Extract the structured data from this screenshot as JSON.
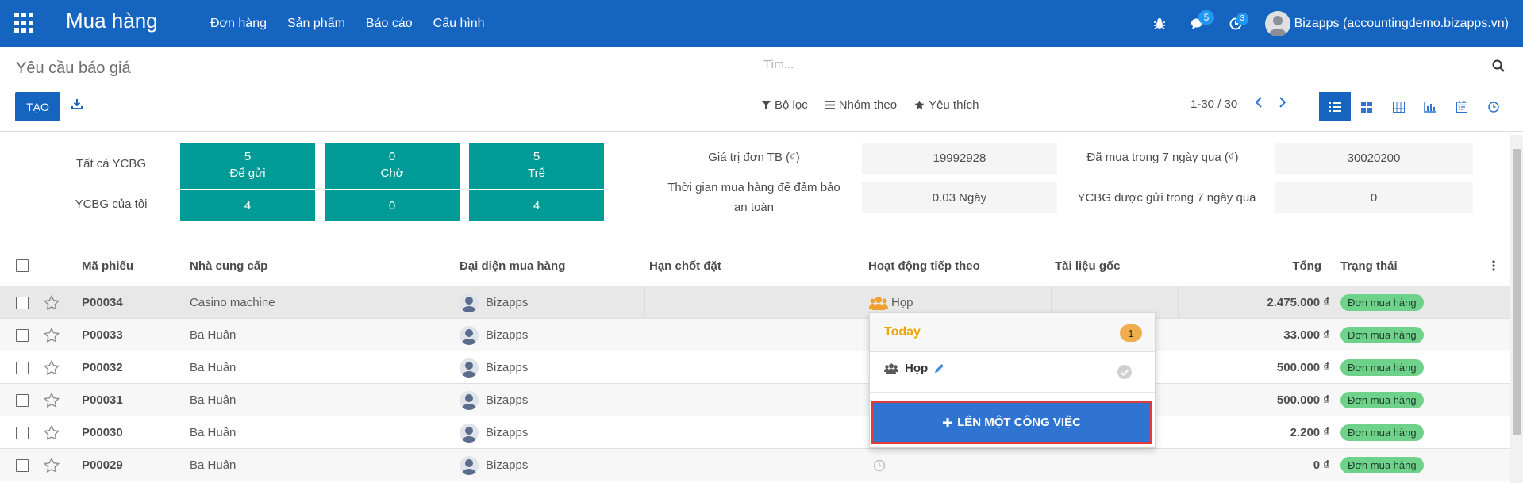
{
  "navbar": {
    "app_title": "Mua hàng",
    "menu": [
      "Đơn hàng",
      "Sản phẩm",
      "Báo cáo",
      "Cấu hình"
    ],
    "messages_badge": "5",
    "activities_badge": "3",
    "user": "Bizapps (accountingdemo.bizapps.vn)"
  },
  "control_panel": {
    "breadcrumb": "Yêu cầu báo giá",
    "search_placeholder": "Tìm...",
    "create_label": "TẠO",
    "filters_label": "Bộ lọc",
    "group_by_label": "Nhóm theo",
    "favorites_label": "Yêu thích",
    "pager": "1-30 / 30"
  },
  "dashboard": {
    "row1_label": "Tất cả YCBG",
    "row2_label": "YCBG của tôi",
    "tiles": [
      {
        "all": "5",
        "label": "Để gửi",
        "mine": "4"
      },
      {
        "all": "0",
        "label": "Chờ",
        "mine": "0"
      },
      {
        "all": "5",
        "label": "Trễ",
        "mine": "4"
      }
    ],
    "stats": {
      "avg_order_label": "Giá trị đơn TB (₫)",
      "avg_order_value": "19992928",
      "lead_time_label_1": "Thời gian mua hàng để đảm bảo",
      "lead_time_label_2": "an toàn",
      "lead_time_value": "0.03  Ngày",
      "purchased_7d_label": "Đã mua trong 7 ngày qua (₫)",
      "purchased_7d_value": "30020200",
      "rfq_sent_7d_label": "YCBG được gửi trong 7 ngày qua",
      "rfq_sent_7d_value": "0"
    }
  },
  "table": {
    "headers": {
      "reference": "Mã phiếu",
      "vendor": "Nhà cung cấp",
      "buyer": "Đại diện mua hàng",
      "deadline": "Hạn chốt đặt",
      "next_activity": "Hoạt động tiếp theo",
      "source": "Tài liệu gốc",
      "total": "Tổng",
      "status": "Trạng thái"
    },
    "rows": [
      {
        "ref": "P00034",
        "vendor": "Casino machine",
        "buyer": "Bizapps",
        "activity": "Họp",
        "total": "2.475.000 ₫",
        "status": "Đơn mua hàng"
      },
      {
        "ref": "P00033",
        "vendor": "Ba Huân",
        "buyer": "Bizapps",
        "activity": "",
        "total": "33.000 ₫",
        "status": "Đơn mua hàng"
      },
      {
        "ref": "P00032",
        "vendor": "Ba Huân",
        "buyer": "Bizapps",
        "activity": "",
        "total": "500.000 ₫",
        "status": "Đơn mua hàng"
      },
      {
        "ref": "P00031",
        "vendor": "Ba Huân",
        "buyer": "Bizapps",
        "activity": "",
        "total": "500.000 ₫",
        "status": "Đơn mua hàng"
      },
      {
        "ref": "P00030",
        "vendor": "Ba Huân",
        "buyer": "Bizapps",
        "activity": "",
        "total": "2.200 ₫",
        "status": "Đơn mua hàng"
      },
      {
        "ref": "P00029",
        "vendor": "Ba Huân",
        "buyer": "Bizapps",
        "activity": "",
        "total": "0 ₫",
        "status": "Đơn mua hàng"
      }
    ]
  },
  "activity_popover": {
    "group_label": "Today",
    "count": "1",
    "item_label": "Họp",
    "schedule_button": "LÊN MỘT CÔNG VIỆC"
  },
  "colors": {
    "navbar": "#1565c0",
    "tile": "#009b96",
    "status_badge": "#6fd28a",
    "today": "#f0a30a",
    "schedule_button": "#2f74d0"
  }
}
